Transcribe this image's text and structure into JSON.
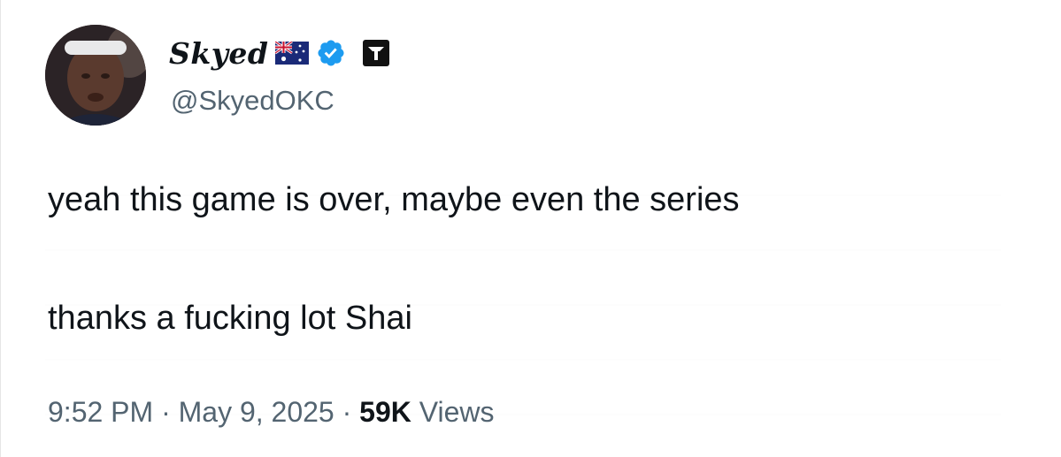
{
  "tweet": {
    "display_name": "Skyed",
    "handle": "@SkyedOKC",
    "text_line_1": "yeah this game is over, maybe even the series",
    "text_line_2": "thanks a fucking lot Shai",
    "time": "9:52 PM",
    "separator": " · ",
    "date": "May 9, 2025",
    "views_count": "59K",
    "views_label": " Views"
  },
  "icons": {
    "flag": "australia-flag-icon",
    "verified": "verified-badge-icon",
    "affiliate": "team-affiliate-badge-icon"
  },
  "colors": {
    "text_primary": "#0f1419",
    "text_secondary": "#536471",
    "verified_blue": "#1d9bf0"
  }
}
